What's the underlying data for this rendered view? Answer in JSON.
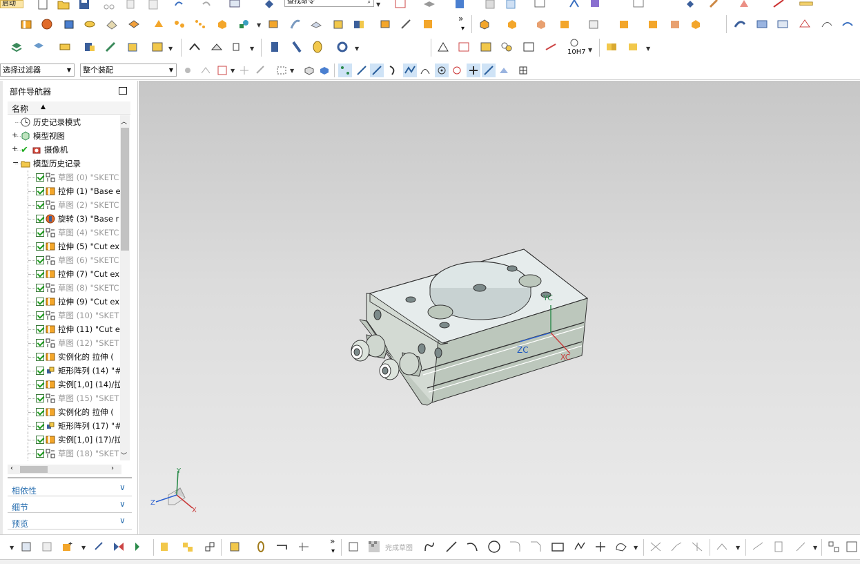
{
  "app": {
    "start_label": "启动"
  },
  "toolbar": {
    "command_search": "查找命令",
    "selection_filter": "选择过滤器",
    "scope": "整个装配",
    "tolerance_label": "10H7"
  },
  "navigator": {
    "title": "部件导航器",
    "column_name": "名称",
    "sort_indicator": "▲",
    "items": [
      {
        "label": "历史记录模式",
        "grey": false
      },
      {
        "label": "模型视图",
        "grey": false
      },
      {
        "label": "摄像机",
        "grey": false
      },
      {
        "label": "模型历史记录",
        "grey": false
      },
      {
        "label": "草图 (0) \"SKETC",
        "grey": true
      },
      {
        "label": "拉伸 (1) \"Base e",
        "grey": false
      },
      {
        "label": "草图 (2) \"SKETC",
        "grey": true
      },
      {
        "label": "旋转 (3) \"Base r",
        "grey": false
      },
      {
        "label": "草图 (4) \"SKETC",
        "grey": true
      },
      {
        "label": "拉伸 (5) \"Cut ex",
        "grey": false
      },
      {
        "label": "草图 (6) \"SKETC",
        "grey": true
      },
      {
        "label": "拉伸 (7) \"Cut ex",
        "grey": false
      },
      {
        "label": "草图 (8) \"SKETC",
        "grey": true
      },
      {
        "label": "拉伸 (9) \"Cut ex",
        "grey": false
      },
      {
        "label": "草图 (10) \"SKET",
        "grey": true
      },
      {
        "label": "拉伸 (11) \"Cut e",
        "grey": false
      },
      {
        "label": "草图 (12) \"SKET",
        "grey": true
      },
      {
        "label": "实例化的 拉伸 (",
        "grey": false
      },
      {
        "label": "矩形阵列 (14) \"#",
        "grey": false
      },
      {
        "label": "实例[1,0] (14)/拉",
        "grey": false
      },
      {
        "label": "草图 (15) \"SKET",
        "grey": true
      },
      {
        "label": "实例化的 拉伸 (",
        "grey": false
      },
      {
        "label": "矩形阵列 (17) \"#",
        "grey": false
      },
      {
        "label": "实例[1,0] (17)/拉",
        "grey": false
      },
      {
        "label": "草图 (18) \"SKET",
        "grey": true
      }
    ],
    "sections": [
      {
        "label": "相依性"
      },
      {
        "label": "细节"
      },
      {
        "label": "预览"
      }
    ]
  },
  "viewport": {
    "axis_labels": {
      "zc": "ZC",
      "xc": "XC",
      "yc": "YC",
      "x": "X",
      "y": "Y",
      "z": "Z"
    }
  },
  "bottom": {
    "finish_sketch": "完成草图"
  },
  "colors": {
    "accent": "#2a6fb0",
    "check": "#1a9a1a",
    "part": "#c9d3c9",
    "viewport_top": "#c7c7c7"
  }
}
